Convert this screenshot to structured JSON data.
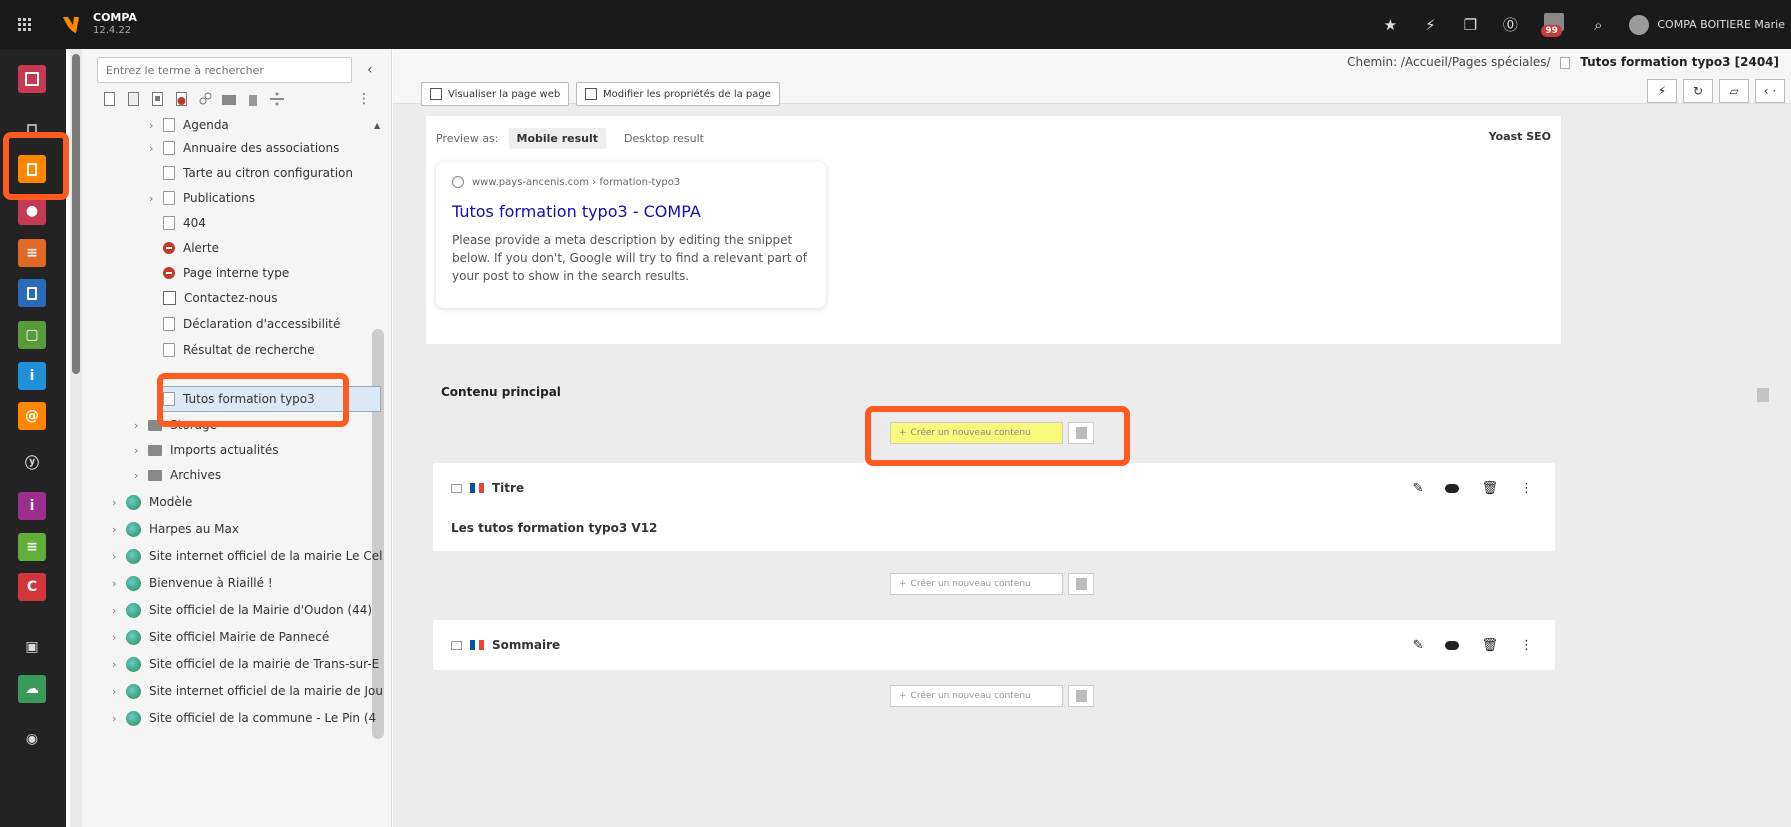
{
  "topbar": {
    "brand_name": "COMPA",
    "version": "12.4.22",
    "badge_count": "99",
    "user_name": "COMPA BOITIERE Marie"
  },
  "tree": {
    "search_placeholder": "Entrez le terme à rechercher",
    "items": [
      {
        "label": "Agenda"
      },
      {
        "label": "Annuaire des associations"
      },
      {
        "label": "Tarte au citron configuration"
      },
      {
        "label": "Publications"
      },
      {
        "label": "404"
      },
      {
        "label": "Alerte"
      },
      {
        "label": "Page interne type"
      },
      {
        "label": "Contactez-nous"
      },
      {
        "label": "Déclaration d'accessibilité"
      },
      {
        "label": "Résultat de recherche"
      },
      {
        "label": "Tutos formation typo3"
      },
      {
        "label": "Storage"
      },
      {
        "label": "Imports actualités"
      },
      {
        "label": "Archives"
      },
      {
        "label": "Modèle"
      },
      {
        "label": "Harpes au Max"
      },
      {
        "label": "Site internet officiel de la mairie Le Cel"
      },
      {
        "label": "Bienvenue à Riaillé !"
      },
      {
        "label": "Site officiel de la Mairie d'Oudon (44)"
      },
      {
        "label": "Site officiel Mairie de Pannecé"
      },
      {
        "label": "Site officiel de la mairie de Trans-sur-E"
      },
      {
        "label": "Site internet officiel de la mairie de Jou"
      },
      {
        "label": "Site officiel de la commune - Le Pin (4"
      }
    ]
  },
  "main": {
    "path_prefix": "Chemin: /Accueil/Pages spéciales/",
    "path_current": "Tutos formation typo3 [2404]",
    "view_btn": "Visualiser la page web",
    "edit_btn": "Modifier les propriétés de la page",
    "preview": {
      "label": "Preview as:",
      "tab_mobile": "Mobile result",
      "tab_desktop": "Desktop result",
      "yoast": "Yoast SEO",
      "url": "www.pays-ancenis.com › formation-typo3",
      "title": "Tutos formation typo3 - COMPA",
      "desc": "Please provide a meta description by editing the snippet below. If you don't, Google will try to find a relevant part of your post to show in the search results."
    },
    "content_title": "Contenu principal",
    "add_content": "Créer un nouveau contenu",
    "elements": [
      {
        "type": "Titre",
        "body": "Les tutos formation typo3 V12"
      },
      {
        "type": "Sommaire",
        "body": ""
      }
    ]
  },
  "colors": {
    "highlight": "#ff5a1f",
    "accent_orange": "#ff8700"
  }
}
